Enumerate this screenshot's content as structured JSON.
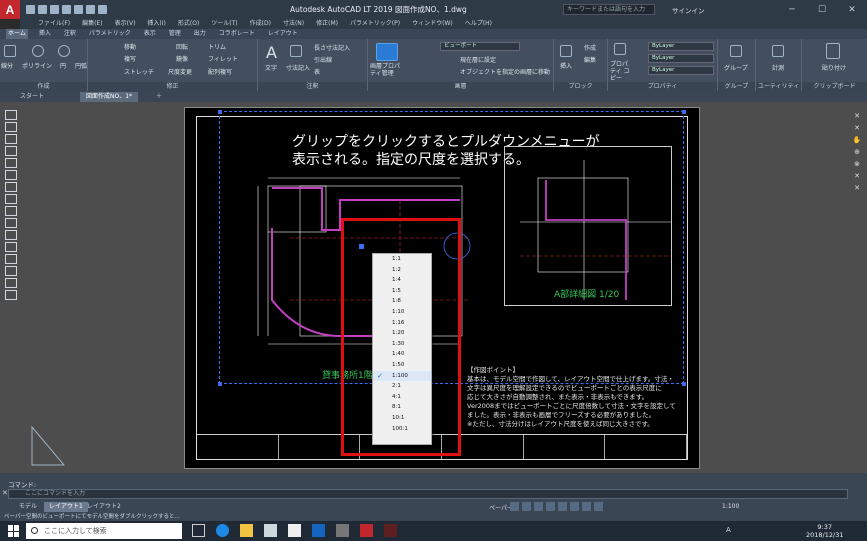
{
  "app": {
    "logo": "A",
    "title": "Autodesk AutoCAD LT 2019   図面作成NO、1.dwg",
    "search_placeholder": "キーワードまたは語句を入力",
    "signin": "サインイン"
  },
  "menubar": [
    "ファイル(F)",
    "編集(E)",
    "表示(V)",
    "挿入(I)",
    "形式(O)",
    "ツール(T)",
    "作成(D)",
    "寸法(N)",
    "修正(M)",
    "パラメトリック(P)",
    "ウィンドウ(W)",
    "ヘルプ(H)"
  ],
  "ribbon_tabs": [
    "ホーム",
    "挿入",
    "注釈",
    "パラメトリック",
    "表示",
    "管理",
    "出力",
    "コラボレート",
    "レイアウト"
  ],
  "ribbon": {
    "groups": [
      {
        "label": "作成",
        "items": [
          "線分",
          "ポリライン",
          "円",
          "円弧"
        ]
      },
      {
        "label": "修正",
        "items": [
          "移動",
          "回転",
          "トリム",
          "複写",
          "鏡像",
          "フィレット",
          "ストレッチ",
          "尺度変更",
          "配列複写"
        ]
      },
      {
        "label": "注釈",
        "items": [
          "文字",
          "寸法記入",
          "長さ寸法記入",
          "引出線",
          "表"
        ]
      },
      {
        "label": "画層",
        "items": [
          "画層プロパティ管理",
          "ビューポート",
          "現在層に設定",
          "オブジェクトを指定の画層に移動"
        ]
      },
      {
        "label": "ブロック",
        "items": [
          "挿入",
          "作成",
          "編集"
        ]
      },
      {
        "label": "プロパティ",
        "items": [
          "プロパティ コピー",
          "ByLayer",
          "ByLayer",
          "ByLayer"
        ]
      },
      {
        "label": "グループ",
        "items": [
          "グループ"
        ]
      },
      {
        "label": "ユーティリティ",
        "items": [
          "計測"
        ]
      },
      {
        "label": "クリップボード",
        "items": [
          "貼り付け"
        ]
      }
    ]
  },
  "file_tabs": [
    "スタート",
    "図面作成NO、1*"
  ],
  "drawing": {
    "callout_line1": "グリップをクリックするとプルダウンメニューが",
    "callout_line2": "表示される。指定の尺度を選択する。",
    "detail_label": "A部詳細図  1/20",
    "plan_label": "貸事務所1階",
    "notes": [
      "【作図ポイント】",
      "基本は、モデル空間で作図して、レイアウト空間で仕上げます。寸法・",
      "文字は異尺度を理解設定できるのでビューポートごとの表示尺度に",
      "応じて大きさが自動調整され、また表示・非表示もできます。",
      "Ver2008まではビューポートごとに尺度倍数して寸法・文字を設定して",
      "ました。表示・非表示も画層でフリーズする必要がありました。",
      "※ただし、寸法分けはレイアウト尺度を使えば同じ大きさです。"
    ]
  },
  "scale_menu": {
    "items": [
      "1:1",
      "1:2",
      "1:4",
      "1:5",
      "1:8",
      "1:10",
      "1:16",
      "1:20",
      "1:30",
      "1:40",
      "1:50",
      "1:100",
      "2:1",
      "4:1",
      "8:1",
      "10:1",
      "100:1"
    ],
    "selected": "1:100"
  },
  "command": {
    "history": "コマンド:",
    "placeholder": "ここにコマンドを入力"
  },
  "layout_tabs": [
    "モデル",
    "レイアウト1",
    "レイアウト2"
  ],
  "status": {
    "paper": "ペーパー",
    "scale": "1:100"
  },
  "status_line": "ペーパー空間のビューポートにてモデル空間をダブルクリックすると...",
  "taskbar": {
    "search_placeholder": "ここに入力して検索",
    "ime": "A",
    "time": "9:37",
    "date": "2018/12/31"
  },
  "colors": {
    "accent_red": "#e01010",
    "green_text": "#34c759",
    "autocad_red": "#c1272d"
  }
}
